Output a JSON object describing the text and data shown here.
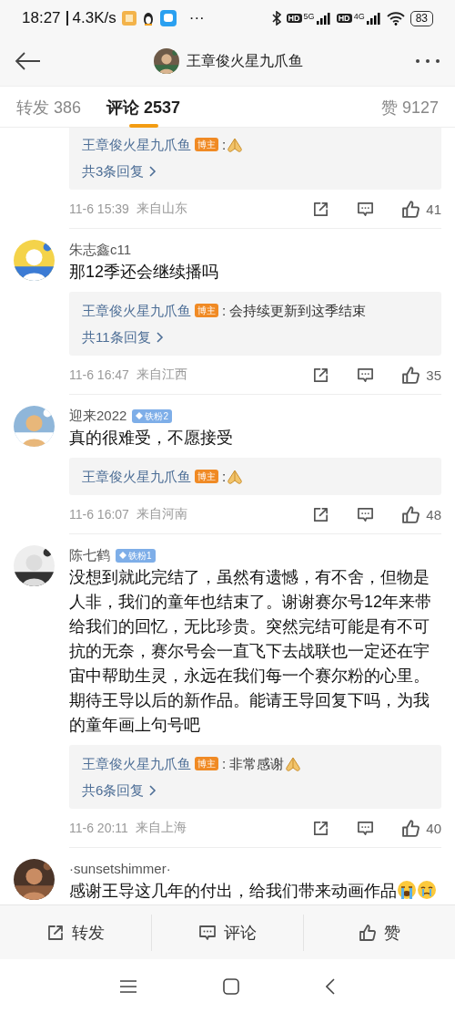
{
  "status_bar": {
    "time": "18:27",
    "speed": "4.3K/s",
    "more": "···",
    "networks": [
      {
        "tag": "HD",
        "net": "5G"
      },
      {
        "tag": "HD",
        "net": "4G"
      }
    ],
    "battery": "83"
  },
  "header": {
    "title": "王章俊火星九爪鱼"
  },
  "tabs": [
    {
      "label": "转发",
      "count": "386",
      "selected": false
    },
    {
      "label": "评论",
      "count": "2537",
      "selected": true
    },
    {
      "label": "赞",
      "count": "9127",
      "selected": false
    }
  ],
  "comments": [
    {
      "reply": {
        "author": "王章俊火星九爪鱼",
        "badge": "博主",
        "text": ":",
        "thanks_emoji": true,
        "more": "共3条回复"
      },
      "time": "11-6 15:39",
      "location": "来自山东",
      "likes": "41"
    },
    {
      "author": "朱志鑫c11",
      "text": "那12季还会继续播吗",
      "reply": {
        "author": "王章俊火星九爪鱼",
        "badge": "博主",
        "text": ": 会持续更新到这季结束",
        "thanks_emoji": false,
        "more": "共11条回复"
      },
      "time": "11-6 16:47",
      "location": "来自江西",
      "likes": "35"
    },
    {
      "author": "迎来2022",
      "fan_badge": "铁粉2",
      "text": "真的很难受，不愿接受",
      "reply": {
        "author": "王章俊火星九爪鱼",
        "badge": "博主",
        "text": ":",
        "thanks_emoji": true
      },
      "time": "11-6 16:07",
      "location": "来自河南",
      "likes": "48"
    },
    {
      "author": "陈七鹤",
      "fan_badge": "铁粉1",
      "text": "没想到就此完结了，虽然有遗憾，有不舍，但物是人非，我们的童年也结束了。谢谢赛尔号12年来带给我们的回忆，无比珍贵。突然完结可能是有不可抗的无奈，赛尔号会一直飞下去战联也一定还在宇宙中帮助生灵，永远在我们每一个赛尔粉的心里。期待王导以后的新作品。能请王导回复下吗，为我的童年画上句号吧",
      "reply": {
        "author": "王章俊火星九爪鱼",
        "badge": "博主",
        "text": ": 非常感谢",
        "thanks_emoji": true,
        "more": "共6条回复"
      },
      "time": "11-6 20:11",
      "location": "来自上海",
      "likes": "40"
    },
    {
      "author": "·sunsetshimmer·",
      "text": "感谢王导这几年的付出，给我们带来动画作品",
      "crying_emojis": true
    }
  ],
  "actions": [
    {
      "kind": "share",
      "label": "转发"
    },
    {
      "kind": "comment",
      "label": "评论"
    },
    {
      "kind": "like",
      "label": "赞"
    }
  ]
}
